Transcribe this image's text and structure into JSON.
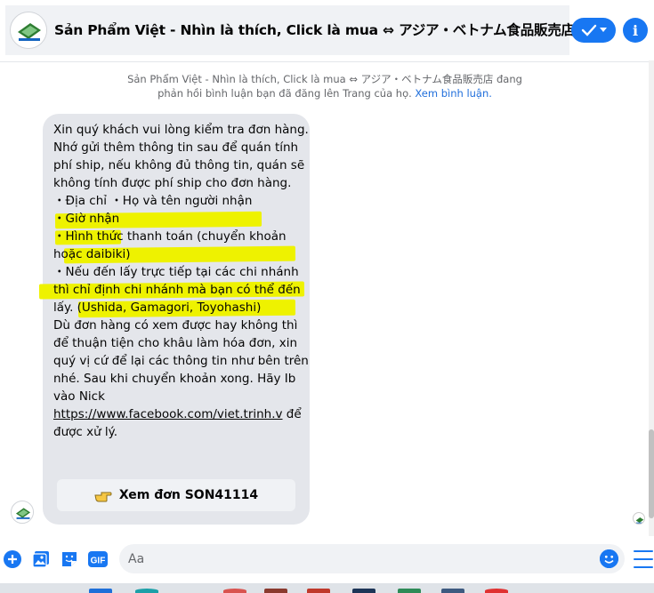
{
  "header": {
    "page_name": "Sản Phẩm Việt - Nhìn là thích, Click là mua ⇔ アジア・ベトナム食品販売店",
    "done_icon": "checkmark-icon",
    "dropdown_icon": "chevron-down-icon",
    "info_icon": "info-icon",
    "info_glyph": "i"
  },
  "notice": {
    "text": "Sản Phẩm Việt - Nhìn là thích, Click là mua ⇔ アジア・ベトナム食品販売店 đang phản hồi bình luận bạn đã đăng lên Trang của họ.",
    "link": "Xem bình luận."
  },
  "message": {
    "intro": "Xin quý khách vui lòng kiểm tra đơn hàng. Nhớ gửi thêm thông tin sau để quán tính phí ship, nếu không đủ thông tin, quán sẽ không tính được phí ship cho đơn hàng.",
    "item_1": "・Địa chỉ ・Họ và tên người nhận",
    "item_2": "・Giờ nhận",
    "item_3": "・Hình thức thanh toán (chuyển khoản hoặc daibiki)",
    "item_4": "・Nếu đến lấy trực tiếp tại các chi nhánh thì chỉ định chi nhánh mà bạn có thể đến lấy. (Ushida, Gamagori, Toyohashi)",
    "outro": "Dù đơn hàng có xem được hay không thì để thuận tiện cho khâu làm hóa đơn, xin quý vị cứ để lại các thông tin như bên trên nhé. Sau khi chuyển khoản xong. Hãy Ib vào Nick",
    "link": "https://www.facebook.com/viet.trinh.v",
    "link_suffix": " để được xử lý."
  },
  "order_button": {
    "label": "Xem đơn SON41114",
    "icon": "pointing-hand-icon"
  },
  "composer": {
    "placeholder": "Aa",
    "icons": [
      "add-icon",
      "photo-icon",
      "sticker-icon",
      "gif-icon",
      "emoji-icon",
      "menu-icon"
    ],
    "gif_label": "GIF"
  },
  "colors": {
    "accent": "#1877f2",
    "bubble": "#e4e6eb",
    "highlight": "#eef200",
    "text": "#050505",
    "muted": "#65676b"
  }
}
